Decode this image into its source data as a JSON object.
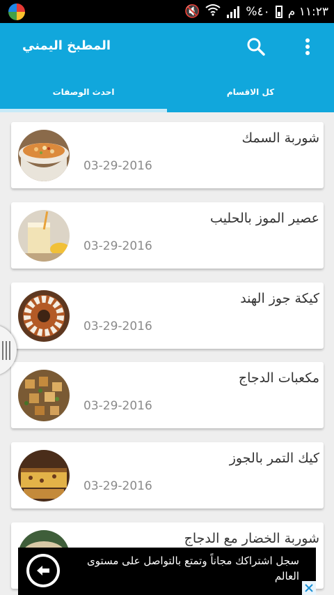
{
  "status_bar": {
    "battery": "%٤٠",
    "time": "١١:٢٣ م"
  },
  "app_bar": {
    "title": "المطبخ اليمني",
    "color": "#11a7dc"
  },
  "tabs": [
    {
      "label": "احدث الوصفات",
      "selected": true
    },
    {
      "label": "كل الاقسام",
      "selected": false
    }
  ],
  "recipes": [
    {
      "title": "شوربة السمك",
      "date": "03-29-2016"
    },
    {
      "title": "عصير الموز بالحليب",
      "date": "03-29-2016"
    },
    {
      "title": "كيكة جوز الهند",
      "date": "03-29-2016"
    },
    {
      "title": "مكعبات الدجاج",
      "date": "03-29-2016"
    },
    {
      "title": "كيك التمر بالجوز",
      "date": "03-29-2016"
    },
    {
      "title": "شوربة الخضار مع الدجاج",
      "date": ""
    }
  ],
  "ad": {
    "text": "سجل اشتراكك مجاناً وتمتع بالتواصل على مستوى العالم"
  }
}
